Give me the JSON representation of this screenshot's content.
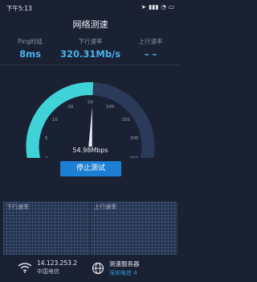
{
  "status": {
    "time": "下午5:13",
    "battery": "100"
  },
  "header": {
    "title": "网络测速"
  },
  "stats": [
    {
      "label": "Ping时延",
      "value": "8ms"
    },
    {
      "label": "下行速率",
      "value": "320.31Mb/s"
    },
    {
      "label": "上行速率",
      "value": "– –"
    }
  ],
  "gauge": {
    "ticks": [
      "0",
      "1",
      "5",
      "10",
      "20",
      "50",
      "100",
      "150",
      "200",
      "300",
      "500"
    ],
    "current_value": 54.98,
    "readout": "54.98Mbps",
    "colors": {
      "active": "#3fd3d8",
      "inactive": "#2c3a5a",
      "needle": "#e9eef6"
    }
  },
  "actions": {
    "stop_label": "停止测试"
  },
  "charts": {
    "down_title": "下行速率",
    "up_title": "上行速率"
  },
  "footer": {
    "ip": "14.123.253.2",
    "isp": "中国电信",
    "server_label": "测速服务器",
    "server_value": "深圳电信 4"
  }
}
